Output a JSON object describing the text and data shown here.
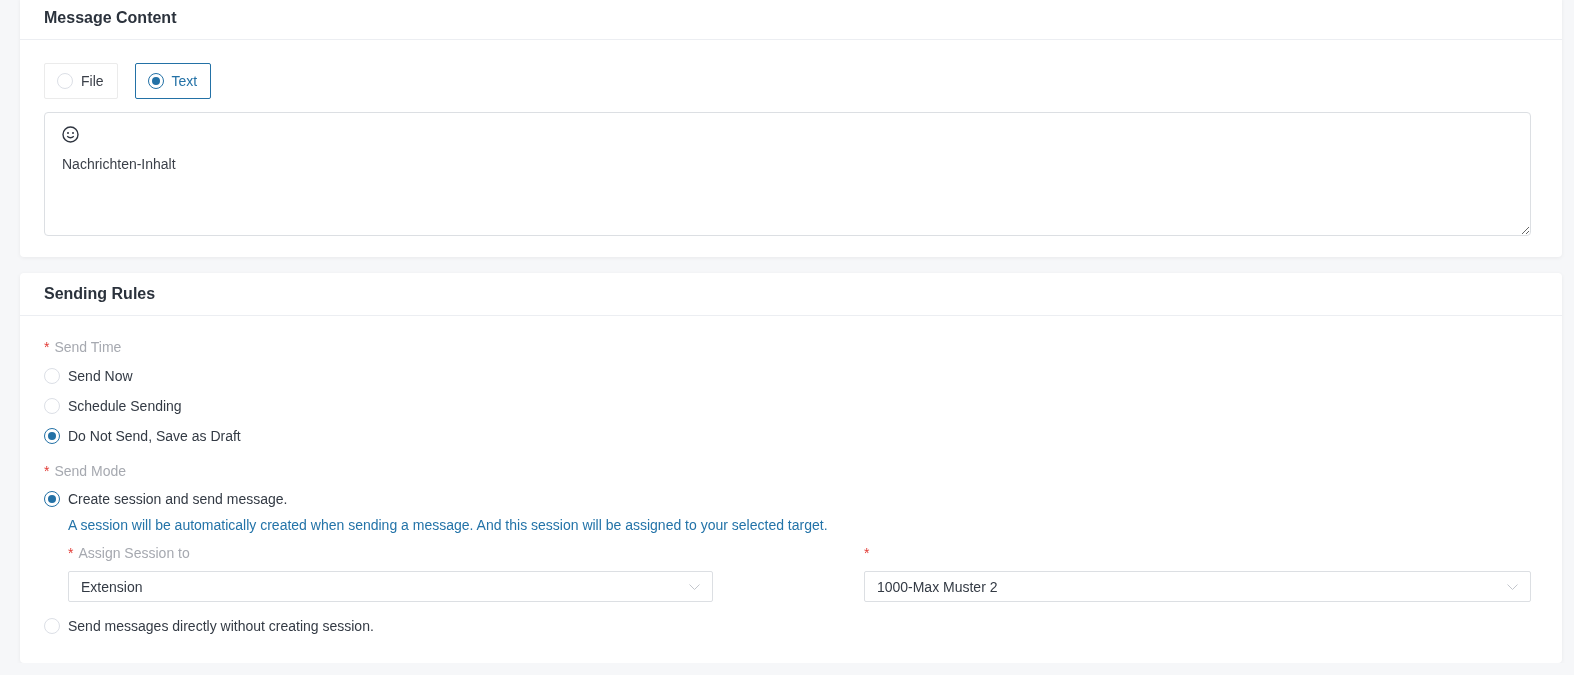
{
  "message_content": {
    "title": "Message Content",
    "content_types": [
      {
        "label": "File",
        "selected": false
      },
      {
        "label": "Text",
        "selected": true
      }
    ],
    "editor": {
      "value": "Nachrichten-Inhalt"
    }
  },
  "sending_rules": {
    "title": "Sending Rules",
    "send_time": {
      "label": "Send Time",
      "required_mark": "*",
      "options": [
        {
          "label": "Send Now",
          "selected": false
        },
        {
          "label": "Schedule Sending",
          "selected": false
        },
        {
          "label": "Do Not Send, Save as Draft",
          "selected": true
        }
      ]
    },
    "send_mode": {
      "label": "Send Mode",
      "required_mark": "*",
      "options": [
        {
          "label": "Create session and send message.",
          "selected": true,
          "hint": "A session will be automatically created when sending a message. And this session will be assigned to your selected target.",
          "fields": [
            {
              "label": "Assign Session to",
              "required_mark": "*",
              "value": "Extension"
            },
            {
              "required_mark": "*",
              "value": "1000-Max Muster 2"
            }
          ]
        },
        {
          "label": "Send messages directly without creating session.",
          "selected": false
        }
      ]
    }
  }
}
